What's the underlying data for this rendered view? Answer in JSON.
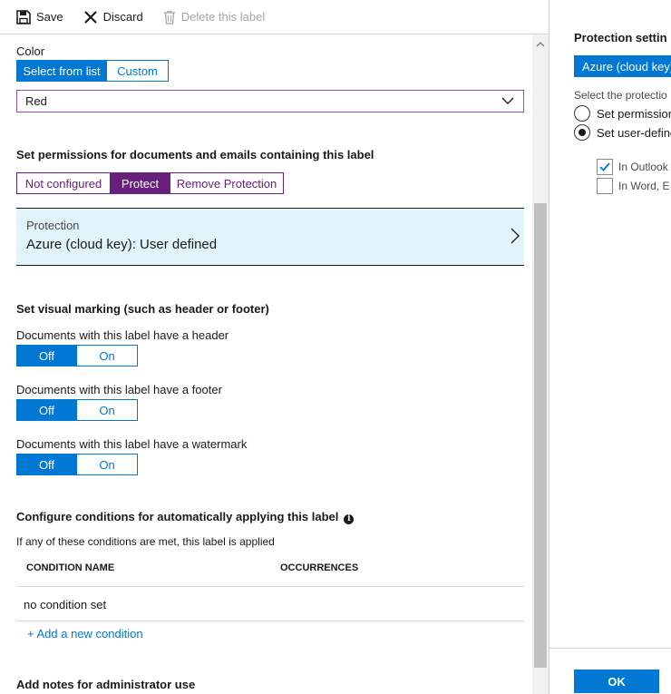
{
  "toolbar": {
    "save_label": "Save",
    "discard_label": "Discard",
    "delete_label": "Delete this label"
  },
  "color": {
    "label": "Color",
    "select_from_list": "Select from list",
    "custom": "Custom",
    "selected_value": "Red"
  },
  "permissions": {
    "title": "Set permissions for documents and emails containing this label",
    "not_configured": "Not configured",
    "protect": "Protect",
    "remove_protection": "Remove Protection",
    "protection_label": "Protection",
    "protection_value": "Azure (cloud key): User defined"
  },
  "visual_marking": {
    "title": "Set visual marking (such as header or footer)",
    "header_label": "Documents with this label have a header",
    "footer_label": "Documents with this label have a footer",
    "watermark_label": "Documents with this label have a watermark",
    "off": "Off",
    "on": "On"
  },
  "conditions": {
    "title": "Configure conditions for automatically applying this label",
    "subtitle": "If any of these conditions are met, this label is applied",
    "col_name": "CONDITION NAME",
    "col_occurrences": "OCCURRENCES",
    "empty_row": "no condition set",
    "add_link": "+ Add a new condition"
  },
  "notes": {
    "title": "Add notes for administrator use"
  },
  "right_panel": {
    "title": "Protection settin",
    "select_value": "Azure (cloud key)",
    "prompt": "Select the protectio",
    "radio_1": "Set permission",
    "radio_2": "Set user-define",
    "check_1": "In Outlook",
    "check_2": "In Word, E",
    "ok_label": "OK"
  },
  "colors": {
    "accent": "#0078d4",
    "purple": "#68217a",
    "protection_bg": "#e1f4fa"
  }
}
